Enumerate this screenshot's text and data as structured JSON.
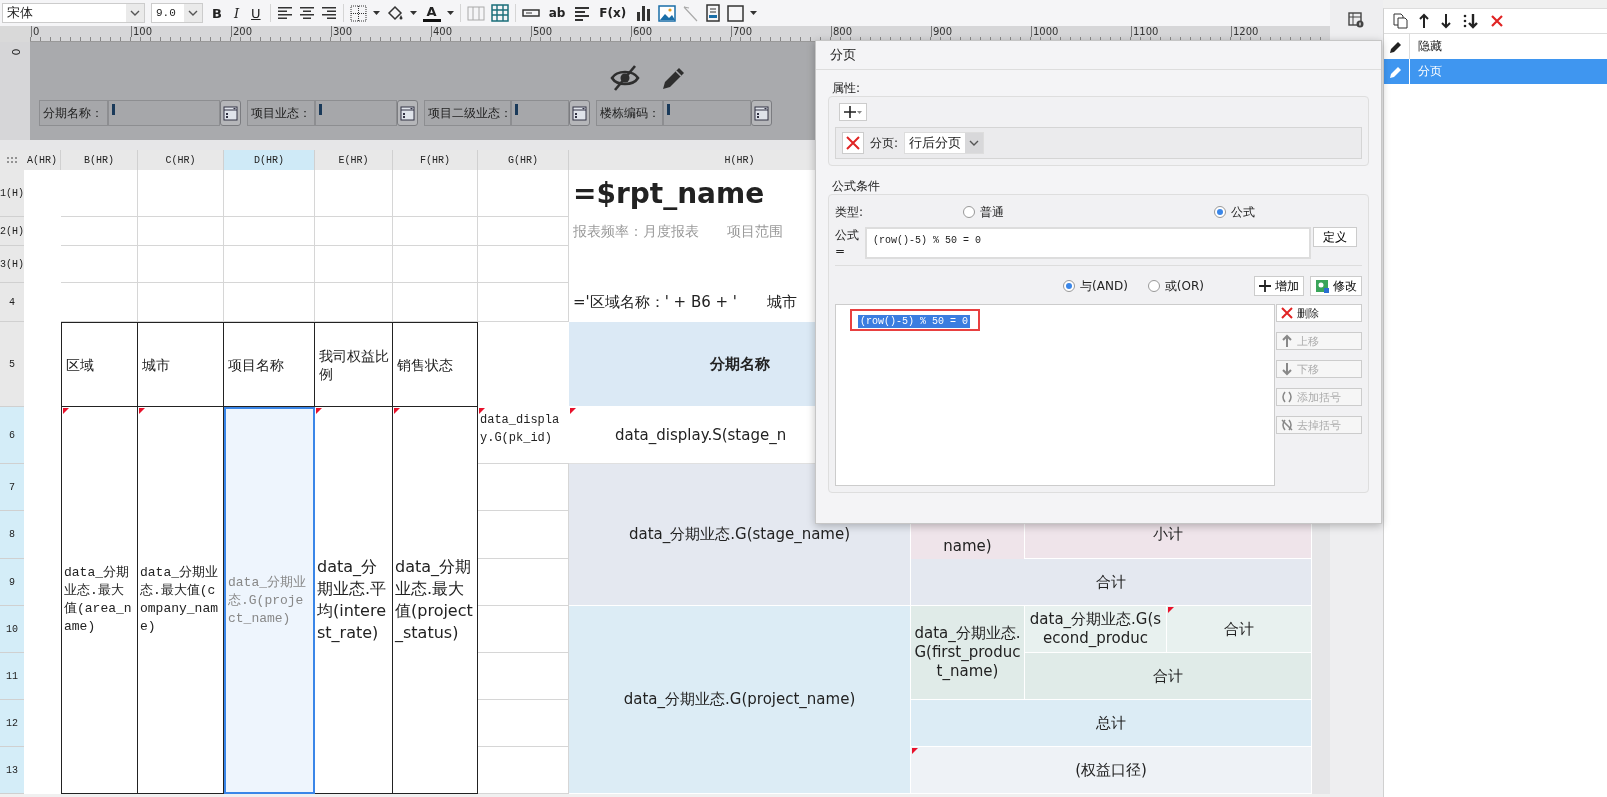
{
  "toolbar": {
    "font": "宋体",
    "font_size": "9.0",
    "format_buttons": [
      "B",
      "I",
      "U"
    ],
    "font_color": "A",
    "text_buttons": [
      "ab",
      "F(x)"
    ]
  },
  "ruler": {
    "labels": [
      "0",
      "100",
      "200",
      "300",
      "400",
      "500",
      "600",
      "700",
      "800",
      "900",
      "1000",
      "1100",
      "1200"
    ],
    "vertical_label": "0"
  },
  "parameters": [
    {
      "label": "分期名称："
    },
    {
      "label": "项目业态："
    },
    {
      "label": "项目二级业态："
    },
    {
      "label": "楼栋编码："
    }
  ],
  "sheet": {
    "column_headers": [
      {
        "label": "A(HR)",
        "selected": false
      },
      {
        "label": "B(HR)",
        "selected": false
      },
      {
        "label": "C(HR)",
        "selected": false
      },
      {
        "label": "D(HR)",
        "selected": true
      },
      {
        "label": "E(HR)",
        "selected": false
      },
      {
        "label": "F(HR)",
        "selected": false
      },
      {
        "label": "G(HR)",
        "selected": false
      },
      {
        "label": "H(HR)",
        "selected": false
      }
    ],
    "row_headers": [
      {
        "label": "1(H)",
        "selected": false
      },
      {
        "label": "2(H)",
        "selected": false
      },
      {
        "label": "3(H)",
        "selected": false
      },
      {
        "label": "4",
        "selected": false
      },
      {
        "label": "5",
        "selected": false
      },
      {
        "label": "6",
        "selected": true
      },
      {
        "label": "7",
        "selected": true
      },
      {
        "label": "8",
        "selected": true
      },
      {
        "label": "9",
        "selected": true
      },
      {
        "label": "10",
        "selected": true
      },
      {
        "label": "11",
        "selected": true
      },
      {
        "label": "12",
        "selected": true
      },
      {
        "label": "13",
        "selected": true
      }
    ],
    "cells": [
      {
        "kind": "title",
        "text": "=$rpt_name",
        "color": "#ffffff",
        "selected": false,
        "flagged": false
      },
      {
        "kind": "note",
        "parts": [
          "报表频率：月度报表",
          "项目范围"
        ],
        "color": "#ffffff",
        "selected": false,
        "flagged": false
      },
      {
        "kind": "formula",
        "parts": [
          "='区域名称：' + B6 + '",
          "城市"
        ],
        "color": "#ffffff",
        "selected": false,
        "flagged": false
      },
      {
        "kind": "heading",
        "text": "分期名称",
        "color": "#dbe9f5",
        "selected": false,
        "flagged": false
      },
      {
        "kind": "lead",
        "text": "data_display.S(stage_n",
        "color": "#ffffff",
        "selected": false,
        "flagged": true
      },
      {
        "kind": "center",
        "text": "data_分期业态.G(stage_name)",
        "color": "#e4e8f0",
        "selected": false,
        "flagged": false
      },
      {
        "kind": "bottom",
        "text": "name)",
        "color": "#efe4ea",
        "selected": false,
        "flagged": false
      },
      {
        "kind": "center",
        "text": "小计",
        "color": "#efe4ea",
        "selected": false,
        "flagged": false
      },
      {
        "kind": "center",
        "text": "合计",
        "color": "#e4e8f0",
        "selected": false,
        "flagged": false
      },
      {
        "kind": "center",
        "text": "data_分期业态.G(project_name)",
        "color": "#dcecf5",
        "selected": false,
        "flagged": false
      },
      {
        "kind": "center",
        "text": "data_分期业态.G(first_product_name)",
        "color": "#e0ebe8",
        "selected": false,
        "flagged": false
      },
      {
        "kind": "center",
        "text": "data_分期业态.G(second_produc",
        "color": "#e8f1ef",
        "selected": false,
        "flagged": false
      },
      {
        "kind": "center",
        "text": "合计",
        "color": "#e8f1ef",
        "selected": false,
        "flagged": true
      },
      {
        "kind": "center",
        "text": "合计",
        "color": "#e0ebe8",
        "selected": false,
        "flagged": false
      },
      {
        "kind": "center",
        "text": "总计",
        "color": "#dcecf5",
        "selected": false,
        "flagged": false
      },
      {
        "kind": "center",
        "text": "(权益口径)",
        "color": "#eef2f6",
        "selected": false,
        "flagged": true
      },
      {
        "kind": "caption",
        "text": "区域",
        "color": "#ffffff",
        "selected": false,
        "flagged": false
      },
      {
        "kind": "caption",
        "text": "城市",
        "color": "#ffffff",
        "selected": false,
        "flagged": false
      },
      {
        "kind": "caption",
        "text": "项目名称",
        "color": "#ffffff",
        "selected": false,
        "flagged": false
      },
      {
        "kind": "caption",
        "text": "我司权益比例",
        "color": "#ffffff",
        "selected": false,
        "flagged": false
      },
      {
        "kind": "caption",
        "text": "销售状态",
        "color": "#ffffff",
        "selected": false,
        "flagged": false
      },
      {
        "kind": "mono",
        "text": "data_分期业态.最大值(area_name)",
        "color": "#ffffff",
        "selected": false,
        "flagged": true
      },
      {
        "kind": "mono",
        "text": "data_分期业态.最大值(company_name)",
        "color": "#ffffff",
        "selected": false,
        "flagged": true
      },
      {
        "kind": "mono",
        "text": "data_分期业态.G(project_name)",
        "color": "#eef5fd",
        "selected": true,
        "flagged": false
      },
      {
        "kind": "sans",
        "text": "data_分期业态.平均(interest_rate)",
        "color": "#ffffff",
        "selected": false,
        "flagged": true
      },
      {
        "kind": "sans",
        "text": "data_分期业态.最大值(project_status)",
        "color": "#ffffff",
        "selected": false,
        "flagged": true
      },
      {
        "kind": "top",
        "text": "data_display.G(pk_id)",
        "color": "#ffffff",
        "selected": false,
        "flagged": true
      }
    ]
  },
  "dialog": {
    "title": "分页",
    "properties": {
      "label": "属性:",
      "rule_label": "分页:",
      "rule_value": "行后分页"
    },
    "condition": {
      "label": "公式条件",
      "type_label": "类型:",
      "types": [
        {
          "label": "普通",
          "selected": false
        },
        {
          "label": "公式",
          "selected": true
        }
      ],
      "formula_label": "公式=",
      "formula": "(row()-5) % 50 = 0",
      "define_button": "定义",
      "joins": [
        {
          "label": "与(AND)",
          "selected": true
        },
        {
          "label": "或(OR)",
          "selected": false
        }
      ],
      "add_button": "增加",
      "modify_button": "修改",
      "conditions": [
        {
          "text": "(row()-5) % 50 = 0",
          "selected": true
        }
      ],
      "side_buttons": [
        {
          "label": "删除",
          "disabled": false
        },
        {
          "label": "上移",
          "disabled": true
        },
        {
          "label": "下移",
          "disabled": true
        },
        {
          "label": "添加括号",
          "disabled": true
        },
        {
          "label": "去掉括号",
          "disabled": true
        }
      ]
    }
  },
  "side_panel": {
    "items": [
      {
        "label": "隐藏",
        "selected": false
      },
      {
        "label": "分页",
        "selected": true
      }
    ]
  }
}
